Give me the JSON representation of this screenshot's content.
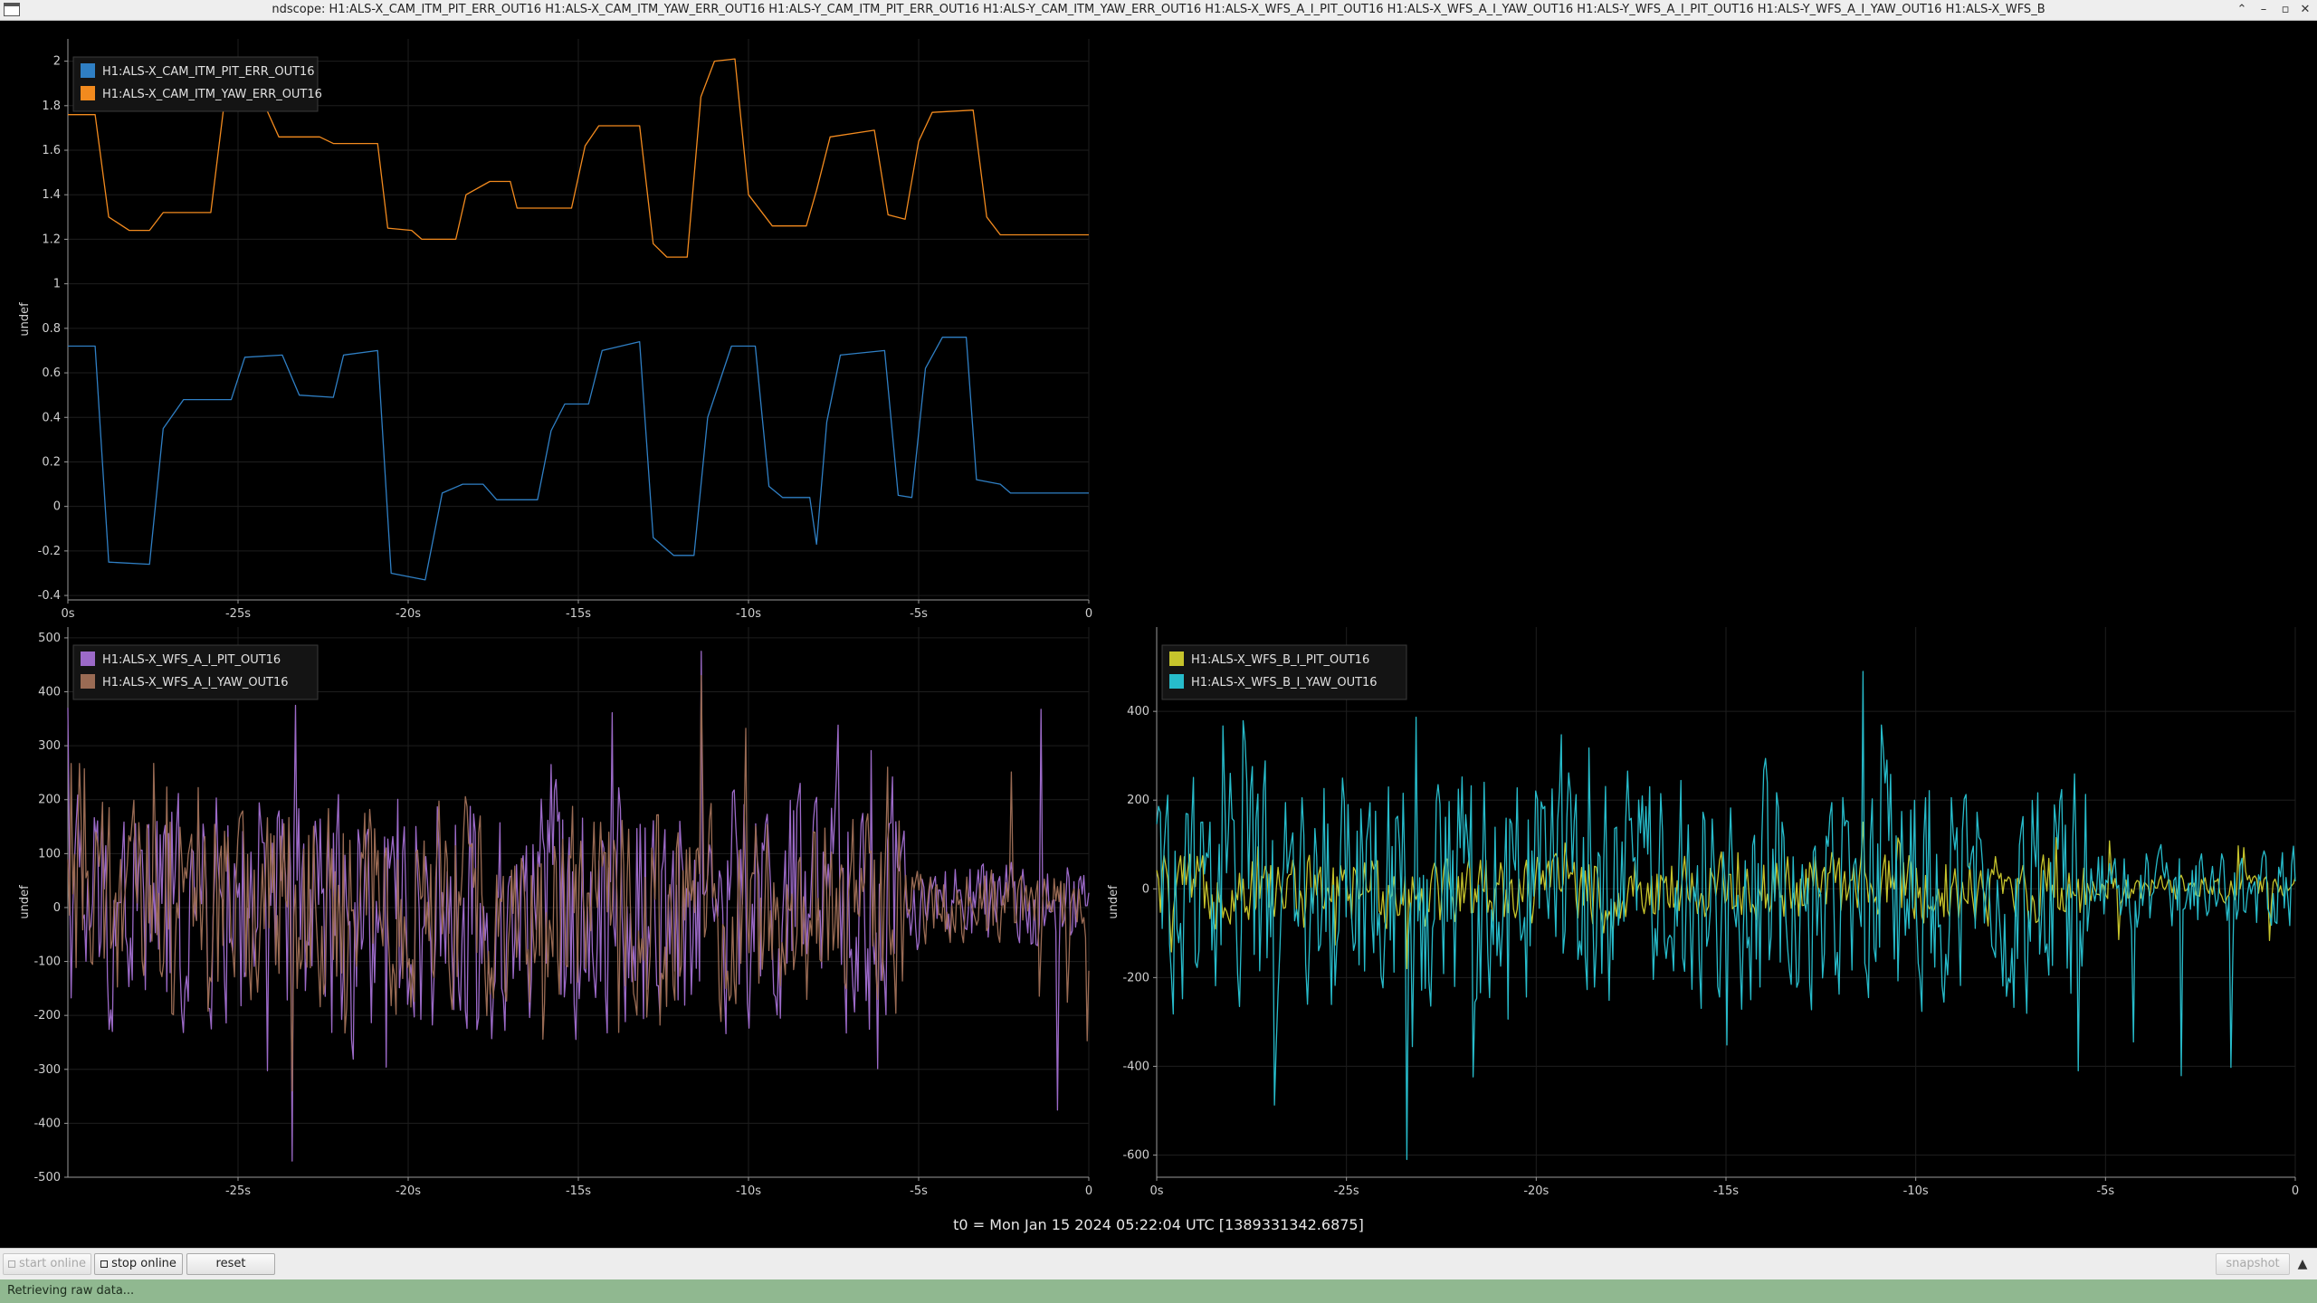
{
  "window": {
    "title": "ndscope: H1:ALS-X_CAM_ITM_PIT_ERR_OUT16 H1:ALS-X_CAM_ITM_YAW_ERR_OUT16 H1:ALS-Y_CAM_ITM_PIT_ERR_OUT16 H1:ALS-Y_CAM_ITM_YAW_ERR_OUT16 H1:ALS-X_WFS_A_I_PIT_OUT16 H1:ALS-X_WFS_A_I_YAW_OUT16 H1:ALS-Y_WFS_A_I_PIT_OUT16 H1:ALS-Y_WFS_A_I_YAW_OUT16 H1:ALS-X_WFS_B",
    "buttons": {
      "minimize": "–",
      "maximize": "▫",
      "close": "✕",
      "up": "⌃"
    }
  },
  "colors": {
    "background": "#000000",
    "grid": "#1e1e1e",
    "axis": "#9a9a9a",
    "blue": "#2f7fc4",
    "orange": "#f28a1e",
    "purple": "#9c6ac8",
    "brown": "#9a6b54",
    "yellow": "#c6c42c",
    "cyan": "#27bccb"
  },
  "time_label": "t0 = Mon Jan 15 2024 05:22:04 UTC [1389331342.6875]",
  "controls": {
    "start_online": "start online",
    "stop_online": "stop online",
    "reset": "reset",
    "snapshot": "snapshot",
    "collapse_icon": "chevron-up-icon"
  },
  "status": "Retrieving raw data...",
  "chart_data": [
    {
      "type": "line",
      "panel": "top-left",
      "xlabel": "",
      "ylabel": "undef",
      "xlim": [
        -30,
        0
      ],
      "ylim": [
        -0.42,
        2.1
      ],
      "xticks": [
        -30,
        -25,
        -20,
        -15,
        -10,
        -5,
        0
      ],
      "xtick_labels": [
        "0s",
        "-25s",
        "-20s",
        "-15s",
        "-10s",
        "-5s",
        "0"
      ],
      "yticks": [
        -0.4,
        -0.2,
        0,
        0.2,
        0.4,
        0.6,
        0.8,
        1,
        1.2,
        1.4,
        1.6,
        1.8,
        2
      ],
      "ytick_labels": [
        "-0.4",
        "-0.2",
        "0",
        "0.2",
        "0.4",
        "0.6",
        "0.8",
        "1",
        "1.2",
        "1.4",
        "1.6",
        "1.8",
        "2"
      ],
      "legend": "top-left",
      "grid": true,
      "series": [
        {
          "name": "H1:ALS-X_CAM_ITM_PIT_ERR_OUT16",
          "color": "#2f7fc4",
          "style": "steps",
          "values": [
            [
              -30,
              0.72
            ],
            [
              -29.2,
              0.72
            ],
            [
              -28.8,
              -0.25
            ],
            [
              -27.6,
              -0.26
            ],
            [
              -27.2,
              0.35
            ],
            [
              -26.6,
              0.48
            ],
            [
              -25.2,
              0.48
            ],
            [
              -24.8,
              0.67
            ],
            [
              -23.7,
              0.68
            ],
            [
              -23.2,
              0.5
            ],
            [
              -22.2,
              0.49
            ],
            [
              -21.9,
              0.68
            ],
            [
              -20.9,
              0.7
            ],
            [
              -20.5,
              -0.3
            ],
            [
              -19.5,
              -0.33
            ],
            [
              -19.0,
              0.06
            ],
            [
              -18.4,
              0.1
            ],
            [
              -17.8,
              0.1
            ],
            [
              -17.4,
              0.03
            ],
            [
              -16.2,
              0.03
            ],
            [
              -15.8,
              0.34
            ],
            [
              -15.4,
              0.46
            ],
            [
              -14.7,
              0.46
            ],
            [
              -14.3,
              0.7
            ],
            [
              -13.2,
              0.74
            ],
            [
              -12.8,
              -0.14
            ],
            [
              -12.2,
              -0.22
            ],
            [
              -11.6,
              -0.22
            ],
            [
              -11.2,
              0.4
            ],
            [
              -10.5,
              0.72
            ],
            [
              -9.8,
              0.72
            ],
            [
              -9.4,
              0.09
            ],
            [
              -9.0,
              0.04
            ],
            [
              -8.2,
              0.04
            ],
            [
              -8.0,
              -0.17
            ],
            [
              -7.7,
              0.38
            ],
            [
              -7.3,
              0.68
            ],
            [
              -6.0,
              0.7
            ],
            [
              -5.6,
              0.05
            ],
            [
              -5.2,
              0.04
            ],
            [
              -4.8,
              0.62
            ],
            [
              -4.3,
              0.76
            ],
            [
              -3.6,
              0.76
            ],
            [
              -3.3,
              0.12
            ],
            [
              -2.6,
              0.1
            ],
            [
              -2.3,
              0.06
            ],
            [
              0,
              0.06
            ]
          ]
        },
        {
          "name": "H1:ALS-X_CAM_ITM_YAW_ERR_OUT16",
          "color": "#f28a1e",
          "style": "steps",
          "values": [
            [
              -30,
              1.76
            ],
            [
              -29.2,
              1.76
            ],
            [
              -28.8,
              1.3
            ],
            [
              -28.2,
              1.24
            ],
            [
              -27.6,
              1.24
            ],
            [
              -27.2,
              1.32
            ],
            [
              -25.8,
              1.32
            ],
            [
              -25.4,
              1.82
            ],
            [
              -24.3,
              1.83
            ],
            [
              -23.8,
              1.66
            ],
            [
              -22.6,
              1.66
            ],
            [
              -22.2,
              1.63
            ],
            [
              -20.9,
              1.63
            ],
            [
              -20.6,
              1.25
            ],
            [
              -19.9,
              1.24
            ],
            [
              -19.6,
              1.2
            ],
            [
              -18.6,
              1.2
            ],
            [
              -18.3,
              1.4
            ],
            [
              -17.6,
              1.46
            ],
            [
              -17.0,
              1.46
            ],
            [
              -16.8,
              1.34
            ],
            [
              -15.2,
              1.34
            ],
            [
              -14.8,
              1.62
            ],
            [
              -14.4,
              1.71
            ],
            [
              -13.2,
              1.71
            ],
            [
              -12.8,
              1.18
            ],
            [
              -12.4,
              1.12
            ],
            [
              -11.8,
              1.12
            ],
            [
              -11.4,
              1.84
            ],
            [
              -11.0,
              2.0
            ],
            [
              -10.4,
              2.01
            ],
            [
              -10.0,
              1.4
            ],
            [
              -9.3,
              1.26
            ],
            [
              -8.3,
              1.26
            ],
            [
              -8.0,
              1.42
            ],
            [
              -7.6,
              1.66
            ],
            [
              -6.3,
              1.69
            ],
            [
              -5.9,
              1.31
            ],
            [
              -5.4,
              1.29
            ],
            [
              -5.0,
              1.64
            ],
            [
              -4.6,
              1.77
            ],
            [
              -3.4,
              1.78
            ],
            [
              -3.0,
              1.3
            ],
            [
              -2.6,
              1.22
            ],
            [
              0,
              1.22
            ]
          ]
        }
      ]
    },
    {
      "type": "line",
      "panel": "bottom-left",
      "xlabel": "",
      "ylabel": "undef",
      "xlim": [
        -30,
        0
      ],
      "ylim": [
        -500,
        520
      ],
      "xticks": [
        -25,
        -20,
        -15,
        -10,
        -5,
        0
      ],
      "xtick_labels": [
        "-25s",
        "-20s",
        "-15s",
        "-10s",
        "-5s",
        "0"
      ],
      "yticks": [
        -500,
        -400,
        -300,
        -200,
        -100,
        0,
        100,
        200,
        300,
        400,
        500
      ],
      "ytick_labels": [
        "-500",
        "-400",
        "-300",
        "-200",
        "-100",
        "0",
        "100",
        "200",
        "300",
        "400",
        "500"
      ],
      "legend": "top-left",
      "grid": true,
      "series": [
        {
          "name": "H1:ALS-X_WFS_A_I_PIT_OUT16",
          "color": "#9c6ac8",
          "style": "noise",
          "peak_max": 475,
          "peak_min": -470,
          "values": []
        },
        {
          "name": "H1:ALS-X_WFS_A_I_YAW_OUT16",
          "color": "#9a6b54",
          "style": "noise",
          "peak_max": 430,
          "peak_min": -340,
          "values": []
        }
      ]
    },
    {
      "type": "line",
      "panel": "bottom-right",
      "xlabel": "",
      "ylabel": "undef",
      "xlim": [
        -30,
        0
      ],
      "ylim": [
        -650,
        590
      ],
      "xticks": [
        -30,
        -25,
        -20,
        -15,
        -10,
        -5,
        0
      ],
      "xtick_labels": [
        "0s",
        "-25s",
        "-20s",
        "-15s",
        "-10s",
        "-5s",
        "0"
      ],
      "yticks": [
        -600,
        -400,
        -200,
        0,
        200,
        400
      ],
      "ytick_labels": [
        "-600",
        "-400",
        "-200",
        "0",
        "200",
        "400"
      ],
      "legend": "top-left",
      "grid": true,
      "series": [
        {
          "name": "H1:ALS-X_WFS_B_I_PIT_OUT16",
          "color": "#c6c42c",
          "style": "noise",
          "peak_max": 150,
          "peak_min": -180,
          "values": []
        },
        {
          "name": "H1:ALS-X_WFS_B_I_YAW_OUT16",
          "color": "#27bccb",
          "style": "noise",
          "peak_max": 490,
          "peak_min": -610,
          "values": []
        }
      ]
    }
  ]
}
